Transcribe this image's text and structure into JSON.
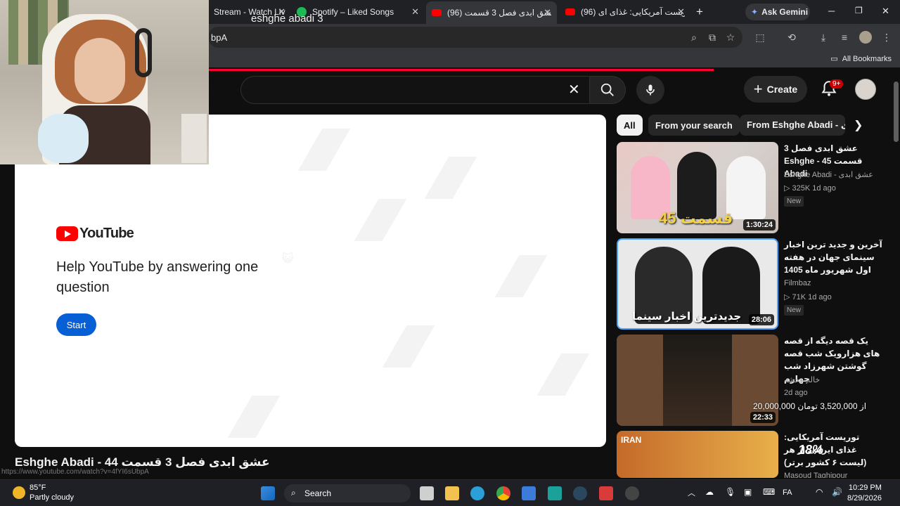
{
  "browser": {
    "tabs": [
      {
        "label": "Stream - Watch Live",
        "active": false
      },
      {
        "label": "Spotify – Liked Songs",
        "active": false
      },
      {
        "label": "(96) عشق ابدی فصل 3 قسمت",
        "active": true
      },
      {
        "label": "(96) توریست آمریکایی: غذای ای",
        "active": false
      }
    ],
    "new_tab": "+",
    "gemini_label": "Ask Gemini",
    "url_fragment": "bpA",
    "all_bookmarks": "All Bookmarks",
    "status_url": "https://www.youtube.com/watch?v=4fYI6sUbpA"
  },
  "youtube": {
    "search": {
      "value": "eshghe abadi 3"
    },
    "create_label": "Create",
    "notifications_badge": "9+",
    "survey": {
      "logo_text": "YouTube",
      "title": "Help YouTube by answering one question",
      "start_label": "Start"
    },
    "video_title": "Eshghe Abadi - عشق ابدی فصل 3 قسمت 44",
    "chips": [
      "All",
      "From your search",
      "From Eshghe Abadi - عشق ابدی"
    ],
    "recommendations": [
      {
        "title": "عشق ابدی فصل 3 قسمت 45 - Eshghe Abadi",
        "channel": "Eshghe Abadi - عشق ابدی",
        "meta": "325K  1d ago",
        "badge": "New",
        "duration": "1:30:24",
        "thumb_text": "قسمت 45"
      },
      {
        "title": "آخرین و جدید ترین اخبار سینمای جهان در هفته اول شهریور ماه 1405",
        "channel": "Filmbaz",
        "meta": "71K  1d ago",
        "badge": "New",
        "duration": "28:06",
        "thumb_text": "جدیدترین اخبار سینما"
      },
      {
        "title": "یک قصه دیگه از قصه های هزارویک شب قصه گوشتن شهرزاد شب چهارم",
        "channel": "خاله محشه",
        "meta": "2d ago",
        "badge": "",
        "duration": "22:33",
        "thumb_text": ""
      },
      {
        "title": "توریست آمریکایی: غذای ایرانی از هر (لیست ۶ کشور برتر)",
        "channel": "Masoud Taghipour",
        "meta": "",
        "badge": "",
        "duration": "",
        "thumb_text": "IRAN"
      }
    ],
    "price_overlay": "20,000,000 از 3,520,000 تومان",
    "percent_overlay": "18%"
  },
  "taskbar": {
    "weather_temp": "85°F",
    "weather_desc": "Partly cloudy",
    "search_label": "Search",
    "lang": "FA",
    "time": "10:29 PM",
    "date": "8/29/2026"
  }
}
